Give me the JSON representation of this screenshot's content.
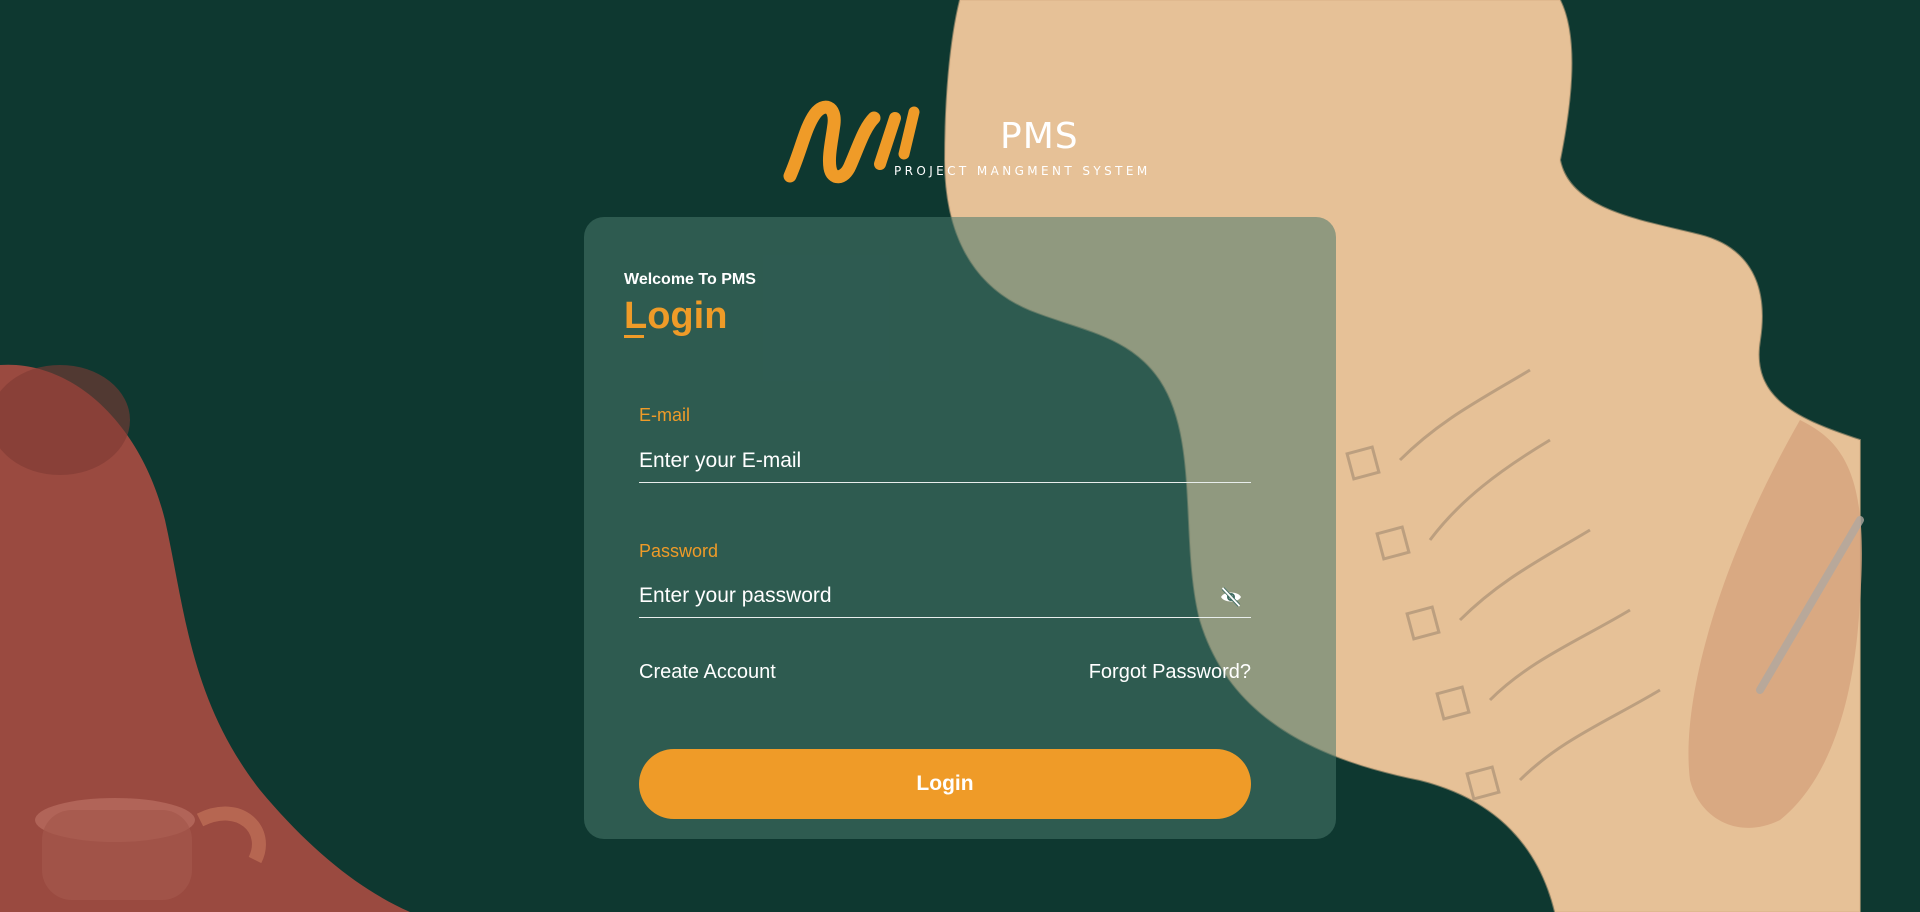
{
  "brand": {
    "title": "PMS",
    "subtitle": "PROJECT MANGMENT SYSTEM",
    "accent": "#ef9b28",
    "background": "#0e3830"
  },
  "login_card": {
    "welcome": "Welcome To PMS",
    "heading": "Login",
    "email": {
      "label": "E-mail",
      "placeholder": "Enter your E-mail",
      "value": ""
    },
    "password": {
      "label": "Password",
      "placeholder": "Enter your password",
      "value": "",
      "toggle_icon": "eye-slash-icon"
    },
    "create_account": "Create Account",
    "forgot_password": "Forgot Password?",
    "submit_label": "Login"
  }
}
